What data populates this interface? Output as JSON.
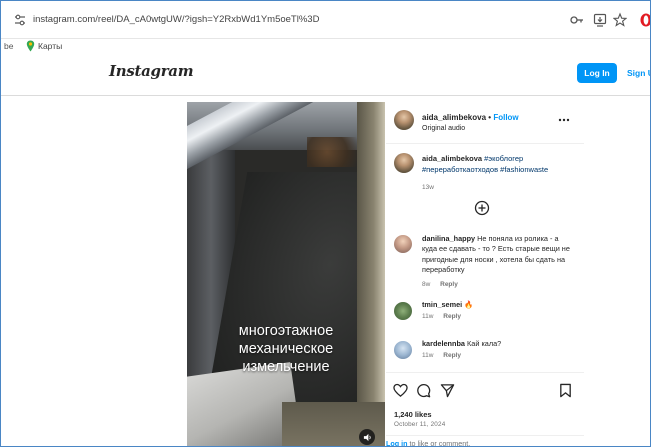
{
  "browser": {
    "url": "instagram.com/reel/DA_cA0wtgUW/?igsh=Y2RxbWd1Ym5oeTl%3D",
    "icons": [
      "tune-icon",
      "key-icon",
      "install-icon",
      "star-icon",
      "opera-icon"
    ]
  },
  "bookmarks": {
    "cut_label": "be",
    "maps_label": "Карты"
  },
  "header": {
    "logo": "Instagram",
    "login_label": "Log In",
    "signup_label": "Sign Up"
  },
  "video": {
    "caption_lines": [
      "многоэтажное",
      "механическое",
      "измельчение"
    ]
  },
  "post": {
    "author": "aida_alimbekova",
    "separator": "•",
    "follow_label": "Follow",
    "audio": "Original audio",
    "caption": {
      "user": "aida_alimbekova",
      "tags": "#экоблогер #переработкаотходов #fashionwaste",
      "time": "13w"
    },
    "comments": [
      {
        "user": "danilina_happy",
        "text": "Не поняла из ролика - а куда ее сдавать - то ? Есть старые вещи не пригодные для носки , хотела бы сдать на переработку",
        "time": "8w",
        "reply": "Reply"
      },
      {
        "user": "tmin_semei",
        "text": "🔥",
        "time": "11w",
        "reply": "Reply"
      },
      {
        "user": "kardelennba",
        "text": "Кай кала?",
        "time": "11w",
        "reply": "Reply"
      }
    ],
    "likes": "1,240 likes",
    "date": "October 11, 2024",
    "login_prompt_link": "Log in",
    "login_prompt_rest": " to like or comment."
  }
}
